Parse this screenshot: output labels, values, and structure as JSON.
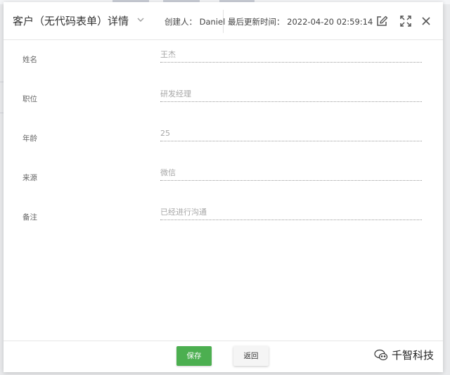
{
  "header": {
    "title": "客户（无代码表单）详情",
    "creator": "创建人：  Daniel",
    "updated": "最后更新时间：  2022-04-20 02:59:14",
    "icons": {
      "prev": "chevron-up-icon",
      "next": "chevron-down-icon",
      "edit": "edit-icon",
      "fullscreen": "fullscreen-icon",
      "close": "close-icon"
    }
  },
  "form": {
    "fields": [
      {
        "label": "姓名",
        "value": "王杰"
      },
      {
        "label": "职位",
        "value": "研发经理"
      },
      {
        "label": "年龄",
        "value": "25"
      },
      {
        "label": "来源",
        "value": "微信"
      },
      {
        "label": "备注",
        "value": "已经进行沟通"
      }
    ]
  },
  "footer": {
    "save_label": "保存",
    "back_label": "返回"
  },
  "watermark": {
    "text": "千智科技",
    "icon": "wechat-icon"
  },
  "colors": {
    "primary": "#4caf50",
    "field_text": "#a7a7a7",
    "label_text": "#666666"
  }
}
